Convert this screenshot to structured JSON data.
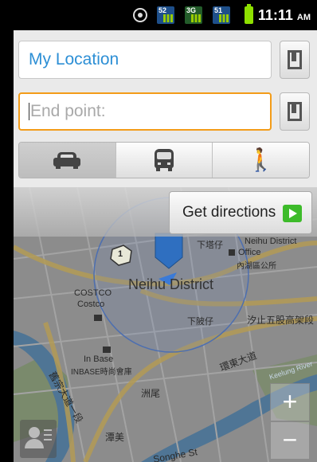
{
  "status_bar": {
    "signal_1_label": "52",
    "signal_2_label": "3G",
    "signal_3_label": "51",
    "time": "11:11",
    "ampm": "AM"
  },
  "directions_form": {
    "start_value": "My Location",
    "end_placeholder": "End point:",
    "modes": [
      {
        "name": "driving",
        "icon": "car-icon",
        "selected": true
      },
      {
        "name": "transit",
        "icon": "bus-icon",
        "selected": false
      },
      {
        "name": "walking",
        "icon": "walking-icon",
        "selected": false
      }
    ],
    "get_directions_label": "Get directions"
  },
  "map": {
    "labels": {
      "neihu_district": "Neihu District",
      "neihu_district_top": "Neihu District",
      "office": "Office",
      "office_cn": "內湖區公所",
      "costco": "COSTCO",
      "costco_cn": "Costco",
      "xiazhen": "下塔仔",
      "xiazhen2": "下陂仔",
      "wudu": "汐止五股高架段",
      "in_base": "In Base",
      "inbase_cn": "INBASE時尚會庫",
      "circle_road": "環東大道",
      "jiuzong": "舊宗大道一段",
      "zhouwei": "洲尾",
      "keelung_river": "Keelung River",
      "tanmei": "潭美",
      "songhe_st": "Songhe St",
      "route_num": "1"
    },
    "zoom_in": "+",
    "zoom_out": "−"
  }
}
